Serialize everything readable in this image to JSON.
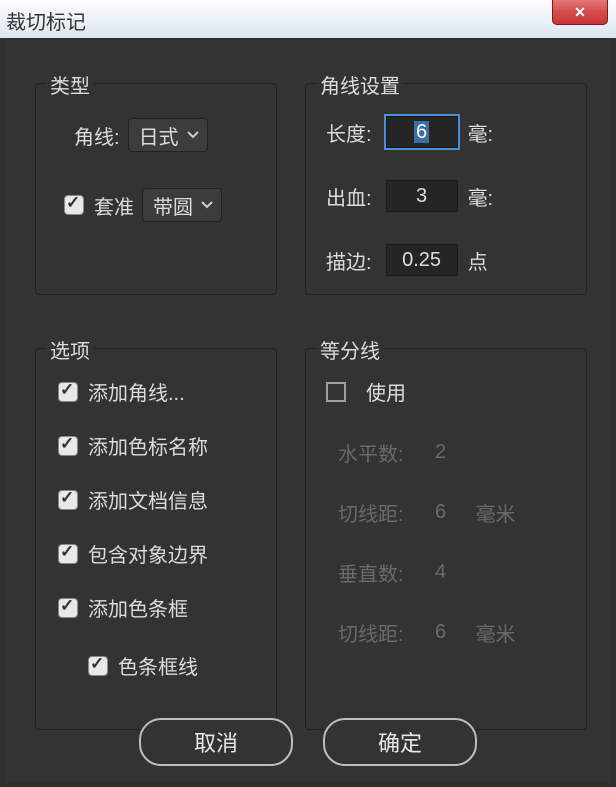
{
  "window": {
    "title": "裁切标记"
  },
  "type_section": {
    "legend": "类型",
    "corner_label": "角线:",
    "corner_value": "日式",
    "registration_label": "套准",
    "registration_checked": true,
    "registration_value": "带圆"
  },
  "corner_section": {
    "legend": "角线设置",
    "length_label": "长度:",
    "length_value": "6",
    "length_unit": "毫:",
    "bleed_label": "出血:",
    "bleed_value": "3",
    "bleed_unit": "毫:",
    "stroke_label": "描边:",
    "stroke_value": "0.25",
    "stroke_unit": "点"
  },
  "options_section": {
    "legend": "选项",
    "items": [
      {
        "label": "添加角线...",
        "checked": true
      },
      {
        "label": "添加色标名称",
        "checked": true
      },
      {
        "label": "添加文档信息",
        "checked": true
      },
      {
        "label": "包含对象边界",
        "checked": true
      },
      {
        "label": "添加色条框",
        "checked": true
      }
    ],
    "sub": {
      "label": "色条框线",
      "checked": true
    }
  },
  "divide_section": {
    "legend": "等分线",
    "use_label": "使用",
    "use_checked": false,
    "rows": [
      {
        "label": "水平数:",
        "value": "2",
        "unit": ""
      },
      {
        "label": "切线距:",
        "value": "6",
        "unit": "毫米"
      },
      {
        "label": "垂直数:",
        "value": "4",
        "unit": ""
      },
      {
        "label": "切线距:",
        "value": "6",
        "unit": "毫米"
      }
    ]
  },
  "buttons": {
    "cancel": "取消",
    "ok": "确定"
  }
}
